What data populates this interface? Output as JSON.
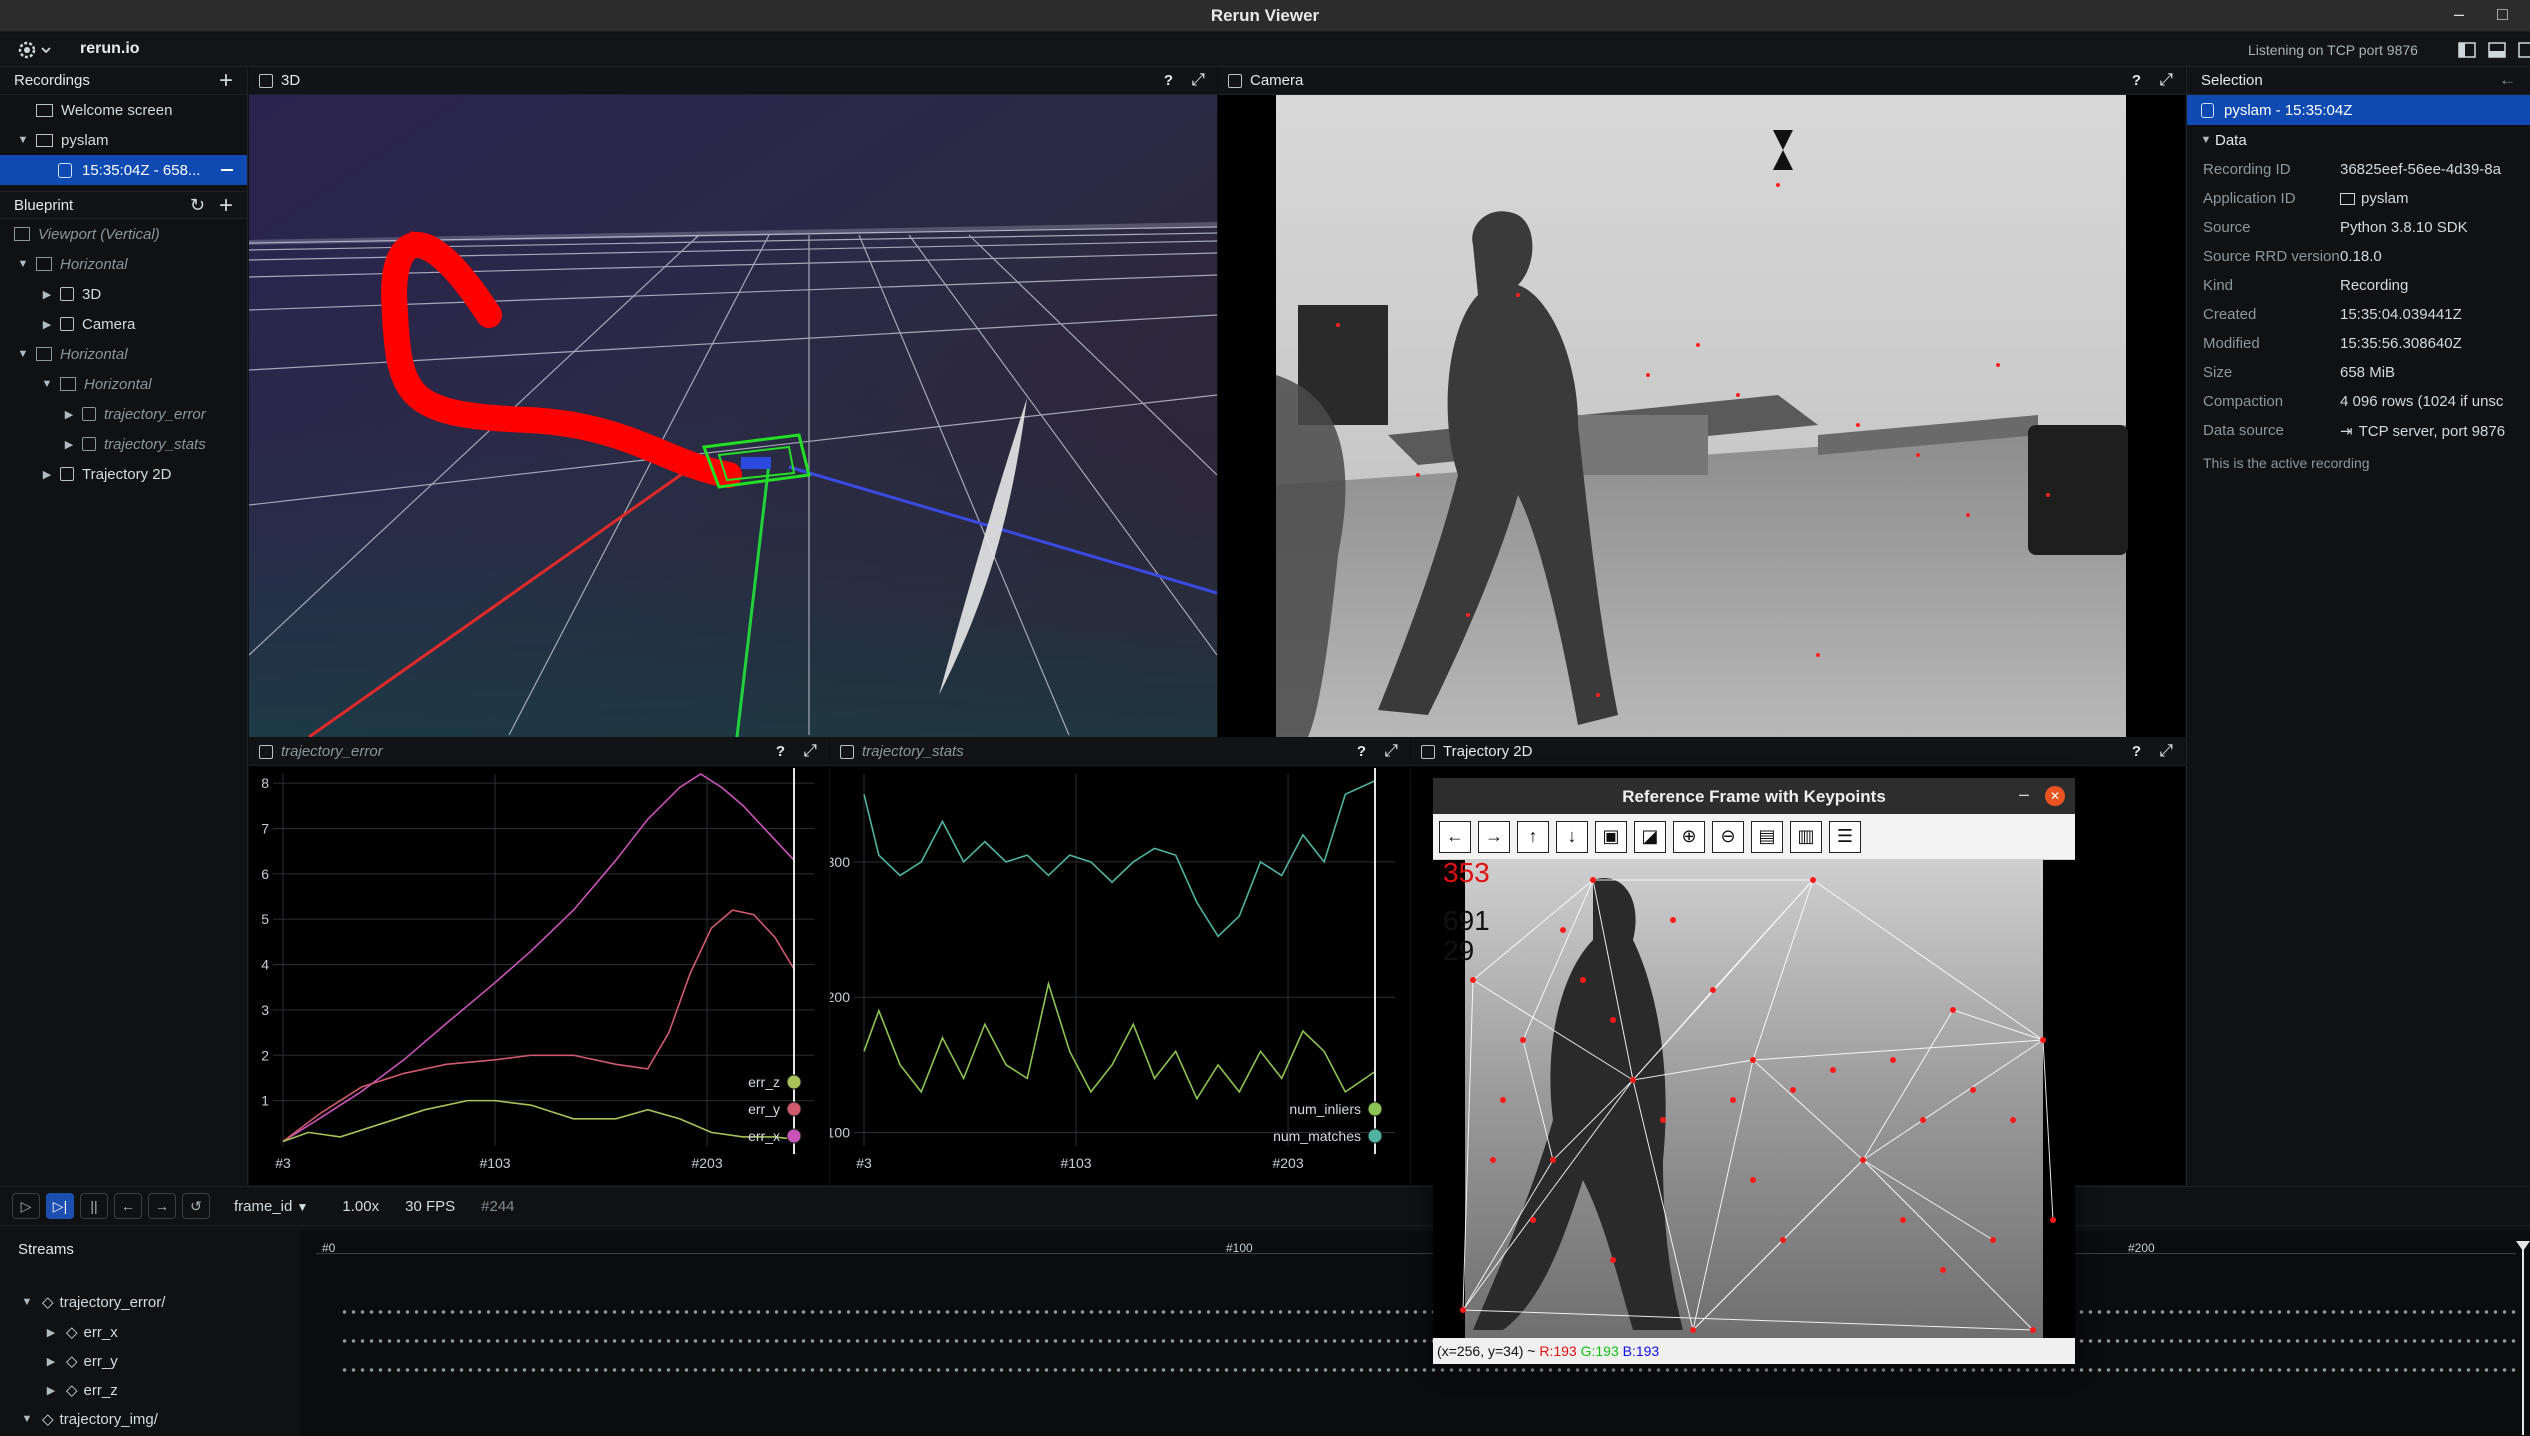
{
  "window": {
    "title": "Rerun Viewer",
    "minimize": "–",
    "maximize": "□"
  },
  "topbar": {
    "app": "rerun.io",
    "status": "Listening on TCP port 9876"
  },
  "recordings": {
    "title": "Recordings",
    "items": [
      {
        "label": "Welcome screen"
      },
      {
        "label": "pyslam"
      },
      {
        "label": "15:35:04Z - 658..."
      }
    ]
  },
  "blueprint": {
    "title": "Blueprint",
    "items": [
      {
        "label": "Viewport (Vertical)"
      },
      {
        "label": "Horizontal"
      },
      {
        "label": "3D"
      },
      {
        "label": "Camera"
      },
      {
        "label": "Horizontal"
      },
      {
        "label": "Horizontal"
      },
      {
        "label": "trajectory_error"
      },
      {
        "label": "trajectory_stats"
      },
      {
        "label": "Trajectory 2D"
      }
    ]
  },
  "views": {
    "view3d": "3D",
    "camera": "Camera",
    "traj_error": "trajectory_error",
    "traj_stats": "trajectory_stats",
    "traj2d": "Trajectory 2D",
    "help": "?"
  },
  "selection": {
    "title": "Selection",
    "item": "pyslam - 15:35:04Z",
    "section": "Data",
    "rows": [
      {
        "k": "Recording ID",
        "v": "36825eef-56ee-4d39-8a"
      },
      {
        "k": "Application ID",
        "v": "pyslam"
      },
      {
        "k": "Source",
        "v": "Python 3.8.10 SDK"
      },
      {
        "k": "Source RRD version",
        "v": "0.18.0"
      },
      {
        "k": "Kind",
        "v": "Recording"
      },
      {
        "k": "Created",
        "v": "15:35:04.039441Z"
      },
      {
        "k": "Modified",
        "v": "15:35:56.308640Z"
      },
      {
        "k": "Size",
        "v": "658 MiB"
      },
      {
        "k": "Compaction",
        "v": "4 096 rows (1024 if unsc"
      },
      {
        "k": "Data source",
        "v": "TCP server, port 9876"
      }
    ],
    "note": "This is the active recording"
  },
  "cv_window": {
    "title": "Reference Frame with Keypoints",
    "minimize": "–",
    "close": "✕",
    "count1": "353",
    "count2": "691",
    "count3": "29",
    "status_pos": "(x=256, y=34) ~",
    "status_r": "R:193",
    "status_g": "G:193",
    "status_b": "B:193"
  },
  "timeline": {
    "timeline_name": "frame_id",
    "speed": "1.00x",
    "fps": "30 FPS",
    "frame": "#244",
    "streams_title": "Streams",
    "ticks": [
      "#0",
      "#100",
      "#200"
    ],
    "streams": [
      {
        "label": "trajectory_error/"
      },
      {
        "label": "err_x"
      },
      {
        "label": "err_y"
      },
      {
        "label": "err_z"
      },
      {
        "label": "trajectory_img/"
      }
    ]
  },
  "colors": {
    "accent": "#0f4ab3",
    "err_x": "#c854b8",
    "err_y": "#cf5a6b",
    "err_z": "#a8c25a",
    "num_matches": "#4fb3a0",
    "num_inliers": "#8cc454",
    "trajectory": "#ff0000"
  },
  "chart_data": [
    {
      "type": "line",
      "title": "trajectory_error",
      "x_ticks": [
        "#3",
        "#103",
        "#203"
      ],
      "xlim": [
        3,
        244
      ],
      "ylim": [
        0,
        8.2
      ],
      "y_ticks": [
        1,
        2,
        3,
        4,
        5,
        6,
        7,
        8
      ],
      "series": [
        {
          "name": "err_x",
          "color": "#c854b8",
          "x": [
            3,
            20,
            40,
            60,
            80,
            103,
            120,
            140,
            160,
            175,
            190,
            200,
            210,
            220,
            230,
            244
          ],
          "y": [
            0.1,
            0.6,
            1.2,
            1.9,
            2.7,
            3.6,
            4.3,
            5.2,
            6.3,
            7.2,
            7.9,
            8.2,
            7.9,
            7.5,
            7.0,
            6.3
          ]
        },
        {
          "name": "err_y",
          "color": "#cf5a6b",
          "x": [
            3,
            20,
            40,
            60,
            80,
            103,
            120,
            140,
            160,
            175,
            185,
            195,
            205,
            215,
            225,
            235,
            244
          ],
          "y": [
            0.1,
            0.7,
            1.3,
            1.6,
            1.8,
            1.9,
            2.0,
            2.0,
            1.8,
            1.7,
            2.5,
            3.8,
            4.8,
            5.2,
            5.1,
            4.6,
            3.9
          ]
        },
        {
          "name": "err_z",
          "color": "#a8c25a",
          "x": [
            3,
            15,
            30,
            50,
            70,
            90,
            103,
            120,
            140,
            160,
            175,
            190,
            205,
            220,
            235,
            244
          ],
          "y": [
            0.1,
            0.3,
            0.2,
            0.5,
            0.8,
            1.0,
            1.0,
            0.9,
            0.6,
            0.6,
            0.8,
            0.6,
            0.3,
            0.2,
            0.2,
            0.15
          ]
        }
      ]
    },
    {
      "type": "line",
      "title": "trajectory_stats",
      "x_ticks": [
        "#3",
        "#103",
        "#203"
      ],
      "xlim": [
        3,
        244
      ],
      "ylim": [
        90,
        365
      ],
      "y_ticks": [
        100,
        200,
        300
      ],
      "series": [
        {
          "name": "num_matches",
          "color": "#4fb3a0",
          "x": [
            3,
            10,
            20,
            30,
            40,
            50,
            60,
            70,
            80,
            90,
            100,
            110,
            120,
            130,
            140,
            150,
            160,
            170,
            180,
            190,
            200,
            210,
            220,
            230,
            244
          ],
          "y": [
            350,
            305,
            290,
            300,
            330,
            300,
            315,
            300,
            305,
            290,
            305,
            300,
            285,
            300,
            310,
            305,
            270,
            245,
            260,
            300,
            290,
            320,
            300,
            350,
            360
          ]
        },
        {
          "name": "num_inliers",
          "color": "#8cc454",
          "x": [
            3,
            10,
            20,
            30,
            40,
            50,
            60,
            70,
            80,
            90,
            100,
            110,
            120,
            130,
            140,
            150,
            160,
            170,
            180,
            190,
            200,
            210,
            220,
            230,
            244
          ],
          "y": [
            160,
            190,
            150,
            130,
            170,
            140,
            180,
            150,
            140,
            210,
            160,
            130,
            150,
            180,
            140,
            160,
            125,
            150,
            130,
            160,
            140,
            175,
            160,
            130,
            145
          ]
        }
      ]
    }
  ]
}
